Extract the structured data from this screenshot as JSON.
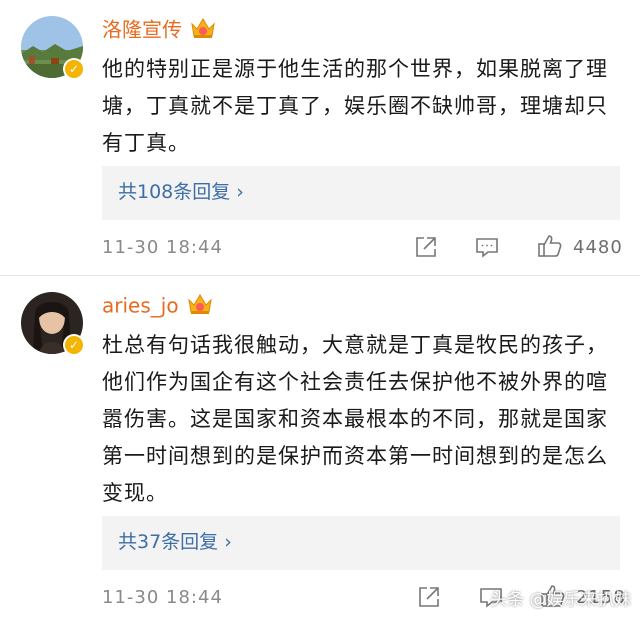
{
  "comments": [
    {
      "username": "洛隆宣传",
      "text": "他的特别正是源于他生活的那个世界，如果脱离了理塘，丁真就不是丁真了，娱乐圈不缺帅哥，理塘却只有丁真。",
      "replies_label": "共108条回复",
      "timestamp": "11-30 18:44",
      "likes": "4480"
    },
    {
      "username": "aries_jo",
      "text": "杜总有句话我很触动，大意就是丁真是牧民的孩子，他们作为国企有这个社会责任去保护他不被外界的喧嚣伤害。这是国家和资本最根本的不同，那就是国家第一时间想到的是保护而资本第一时间想到的是怎么变现。",
      "replies_label": "共37条回复",
      "timestamp": "11-30 18:44",
      "likes": "2158"
    }
  ],
  "watermark": "头条 @娱乐来扒妹",
  "colors": {
    "username": "#e86a1f",
    "reply_link": "#3d6ea5",
    "meta": "#8a8a8a",
    "reply_bg": "#f3f3f3",
    "verified": "#f4b400"
  }
}
